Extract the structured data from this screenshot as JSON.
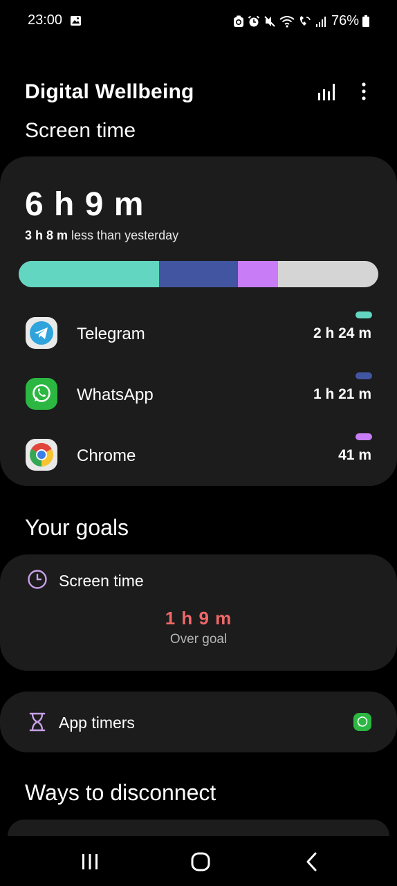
{
  "status_bar": {
    "time": "23:00",
    "battery": "76%",
    "icons": [
      "gallery-icon",
      "recycle-icon",
      "alarm-icon",
      "mute-icon",
      "wifi-icon",
      "wifi-call-icon",
      "signal-icon",
      "battery-icon"
    ]
  },
  "app_bar": {
    "title": "Digital Wellbeing",
    "icons": [
      "stats-icon",
      "more-options-icon"
    ]
  },
  "screen_time": {
    "section_title": "Screen time",
    "total": "6 h 9 m",
    "compare_value": "3 h 8 m",
    "compare_text": " less than yesterday",
    "bar_remaining_color": "#d5d5d5",
    "apps": [
      {
        "name": "Telegram",
        "time": "2 h 24 m",
        "minutes": 144,
        "color": "#62d6c1",
        "icon": "telegram-icon"
      },
      {
        "name": "WhatsApp",
        "time": "1 h 21 m",
        "minutes": 81,
        "color": "#4255a0",
        "icon": "whatsapp-icon"
      },
      {
        "name": "Chrome",
        "time": "41 m",
        "minutes": 41,
        "color": "#c87cf6",
        "icon": "chrome-icon"
      }
    ]
  },
  "goals": {
    "section_title": "Your goals",
    "screen_time_label": "Screen time",
    "screen_time_value": "1 h 9 m",
    "screen_time_status": "Over goal",
    "app_timers_label": "App timers",
    "over_color": "#f06868"
  },
  "disconnect": {
    "section_title": "Ways to disconnect"
  },
  "nav": {
    "icons": [
      "recent-apps-icon",
      "home-icon",
      "back-icon"
    ]
  }
}
